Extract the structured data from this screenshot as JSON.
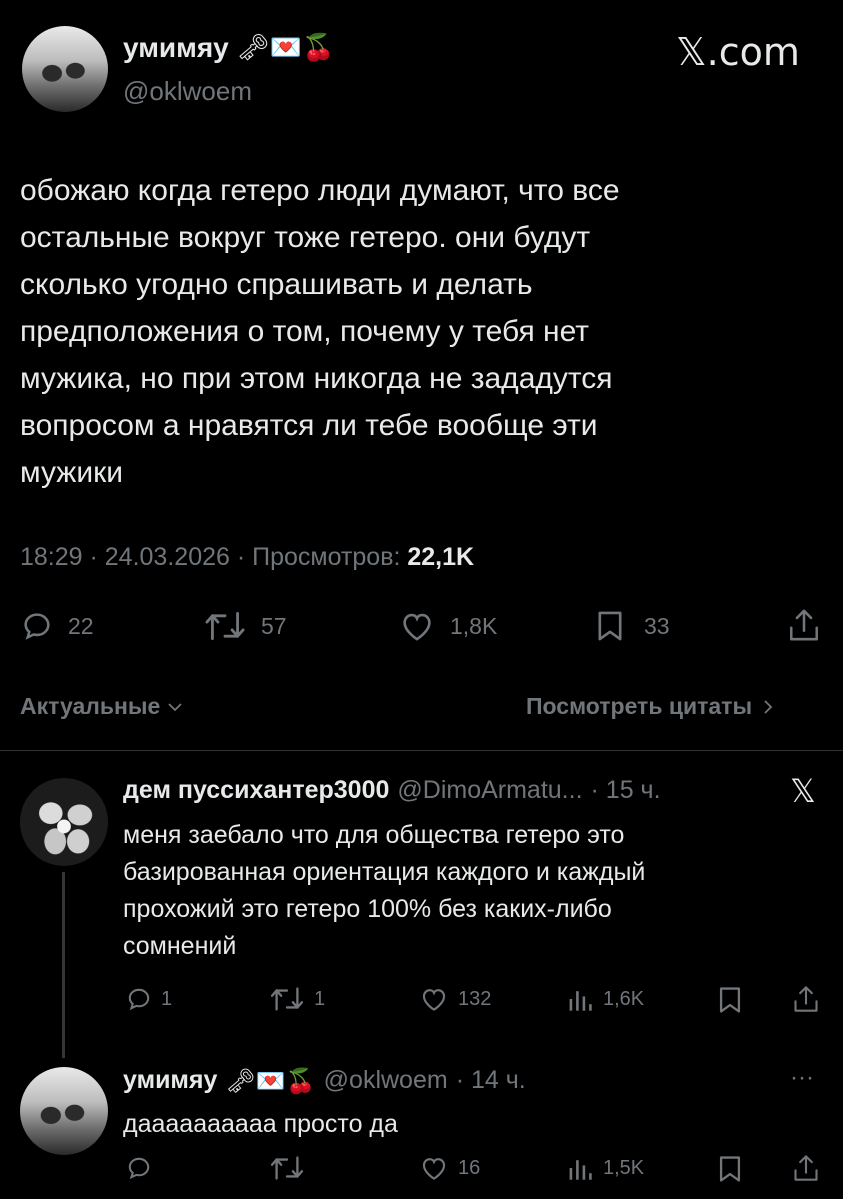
{
  "watermark": "𝕏.com",
  "main_tweet": {
    "display_name": "умимяу",
    "name_emojis": "🗝💌🍒",
    "handle": "@oklwoem",
    "text": "обожаю когда гетеро люди думают, что все\nостальные вокруг тоже гетеро. они будут\nсколько угодно спрашивать и делать\nпредположения о том, почему у тебя нет\nмужика, но при этом никогда не зададутся\nвопросом а нравятся ли тебе вообще эти\nмужики",
    "time": "18:29 · 24.03.2026 · Просмотров: ",
    "views": "22,1K",
    "actions": {
      "replies": "22",
      "retweets": "57",
      "likes": "1,8K",
      "bookmarks": "33"
    }
  },
  "sort": {
    "label": "Актуальные",
    "quotes_link": "Посмотреть цитаты"
  },
  "reply1": {
    "display_name": "дем пуссихантер3000",
    "handle": "@DimoArmatu...",
    "time": "· 15 ч.",
    "text": "меня заебало что для общества гетеро это\nбазированная ориентация каждого и каждый\nпрохожий это гетеро 100% без каких-либо\nсомнений",
    "actions": {
      "replies": "1",
      "retweets": "1",
      "likes": "132",
      "views": "1,6K"
    }
  },
  "reply2": {
    "display_name": "умимяу",
    "name_emojis": "🗝💌🍒",
    "handle": "@oklwoem",
    "time": "· 14 ч.",
    "more": "···",
    "text": "даааааааааа просто да",
    "actions": {
      "replies": "",
      "retweets": "",
      "likes": "16",
      "views": "1,5K"
    }
  }
}
